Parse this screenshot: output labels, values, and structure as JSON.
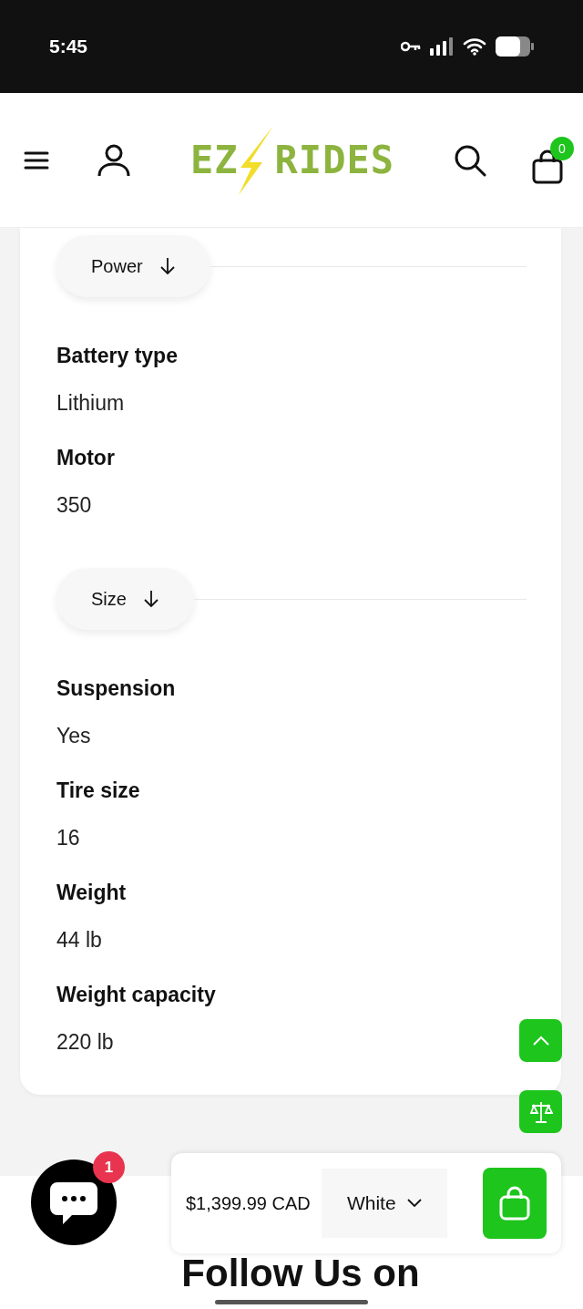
{
  "status_bar": {
    "time": "5:45"
  },
  "header": {
    "logo": {
      "left": "EZ",
      "right": "RIDES"
    },
    "cart_count": "0"
  },
  "spec_groups": [
    {
      "title": "Power",
      "specs": [
        {
          "label": "Battery type",
          "value": "Lithium"
        },
        {
          "label": "Motor",
          "value": "350"
        }
      ]
    },
    {
      "title": "Size",
      "specs": [
        {
          "label": "Suspension",
          "value": "Yes"
        },
        {
          "label": "Tire size",
          "value": "16"
        },
        {
          "label": "Weight",
          "value": "44 lb"
        },
        {
          "label": "Weight capacity",
          "value": "220 lb"
        }
      ]
    }
  ],
  "chat": {
    "badge": "1"
  },
  "sticky_bar": {
    "price": "$1,399.99 CAD",
    "variant": "White"
  },
  "footer": {
    "heading": "Follow Us on"
  }
}
